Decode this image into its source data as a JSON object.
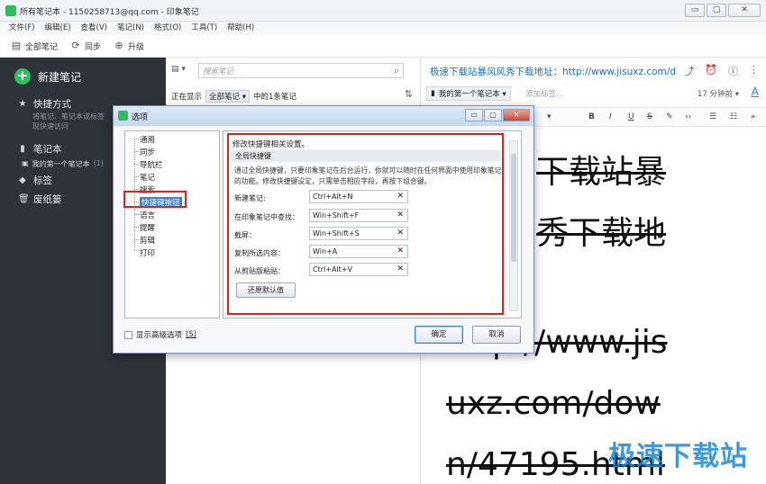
{
  "window": {
    "title": "所有笔记本 - 1150258713@qq.com - 印象笔记",
    "buttons": [
      "▭",
      "▢",
      "✕"
    ]
  },
  "menu": [
    "文件(F)",
    "编辑(E)",
    "查看(V)",
    "笔记(N)",
    "格式(O)",
    "工具(T)",
    "帮助(H)"
  ],
  "toolbar": {
    "all_notes": "全部笔记",
    "sync": "同步",
    "upgrade": "升级"
  },
  "sidebar": {
    "new_note": "新建笔记",
    "shortcuts": "快捷方式",
    "shortcuts_hint_1": "将笔记、笔记本或标签",
    "shortcuts_hint_2": "现快速访问",
    "notebooks": "笔记本",
    "notebook_name": "我的第一个笔记本",
    "notebook_count": "(1)",
    "tags": "标签",
    "trash": "废纸篓"
  },
  "notelist": {
    "search_placeholder": "搜索笔记",
    "showing_prefix": "正在显示",
    "filter": "全部笔记 ▾",
    "showing_suffix": "中的1条笔记"
  },
  "editor": {
    "title": "极速下载站暴风风秀下载地址：http://www.jisuxz.com/d",
    "notebook": "我的第一个笔记本 ▾",
    "add_tag": "添加标签...",
    "time": "17 分钟前 ▾",
    "font_icon": "A",
    "body_lines": [
      "下载站暴",
      "秀下载地",
      "http://www.jis",
      "uxz.com/dow",
      "n/47195.html"
    ],
    "watermark": "极速下载站"
  },
  "dialog": {
    "title": "选项",
    "tree": [
      "通用",
      "同步",
      "导航栏",
      "笔记",
      "搜索",
      "快捷键按钮",
      "语言",
      "提醒",
      "剪辑",
      "打印"
    ],
    "selected_index": 5,
    "header": "修改快捷键相关设置。",
    "group": "全局快捷键",
    "description": "通过全局快捷键，只要印象笔记在后台运行，你就可以随时在任何界面中使用印象笔记的功能。修改快捷键设定，只需单击相应字段，再按下组合键。",
    "shortcuts": [
      {
        "label": "新建笔记:",
        "value": "Ctrl+Alt+N"
      },
      {
        "label": "在印象笔记中查找：",
        "value": "Win+Shift+F"
      },
      {
        "label": "截屏：",
        "value": "Win+Shift+S"
      },
      {
        "label": "复制所选内容：",
        "value": "Win+A"
      },
      {
        "label": "从剪贴版粘贴：",
        "value": "Ctrl+Alt+V"
      }
    ],
    "restore": "还原默认值",
    "advanced": "显示高级选项",
    "advanced_key": "(S)",
    "ok": "确定",
    "cancel": "取消"
  },
  "colors": {
    "sidebar_bg": "#2d3339",
    "accent_green": "#2dbe60",
    "highlight_red": "#e02020",
    "link_blue": "#1b6fb8",
    "selection_blue": "#3c7fd3"
  }
}
